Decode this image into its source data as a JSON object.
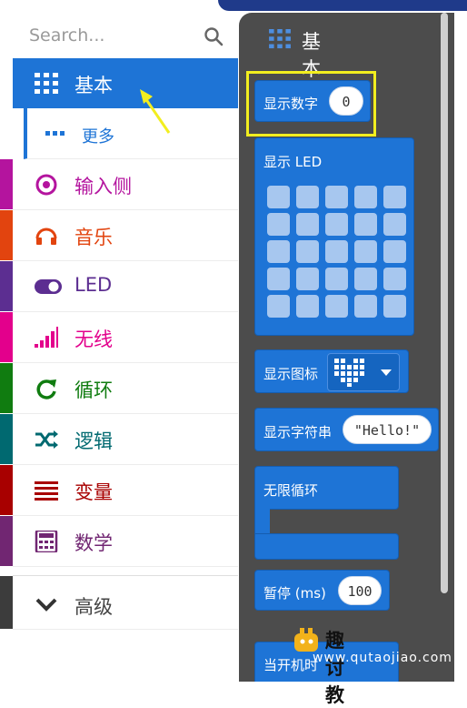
{
  "search": {
    "placeholder": "Search..."
  },
  "toolbox": {
    "categories": [
      {
        "label": "基本",
        "color": "#1e74d6"
      },
      {
        "label": "更多",
        "color": "#1e74d6"
      },
      {
        "label": "输入侧",
        "color": "#b4149e"
      },
      {
        "label": "音乐",
        "color": "#e2440f"
      },
      {
        "label": "LED",
        "color": "#5c2e91"
      },
      {
        "label": "无线",
        "color": "#e3008c"
      },
      {
        "label": "循环",
        "color": "#107c10"
      },
      {
        "label": "逻辑",
        "color": "#006970"
      },
      {
        "label": "变量",
        "color": "#a80000"
      },
      {
        "label": "数学",
        "color": "#712672"
      }
    ],
    "advanced": {
      "label": "高级"
    }
  },
  "flyout": {
    "title": "基本",
    "blocks": {
      "show_number": {
        "label": "显示数字",
        "value": "0"
      },
      "show_leds": {
        "label": "显示 LED"
      },
      "show_icon": {
        "label": "显示图标"
      },
      "show_string": {
        "label": "显示字符串",
        "value": "\"Hello!\""
      },
      "forever": {
        "label": "无限循环"
      },
      "pause": {
        "label": "暂停 (ms)",
        "value": "100"
      },
      "bottom": {
        "label": "当开机时"
      }
    }
  },
  "watermark": {
    "name": "趣讨教",
    "url": "www.qutaojiao.com"
  }
}
